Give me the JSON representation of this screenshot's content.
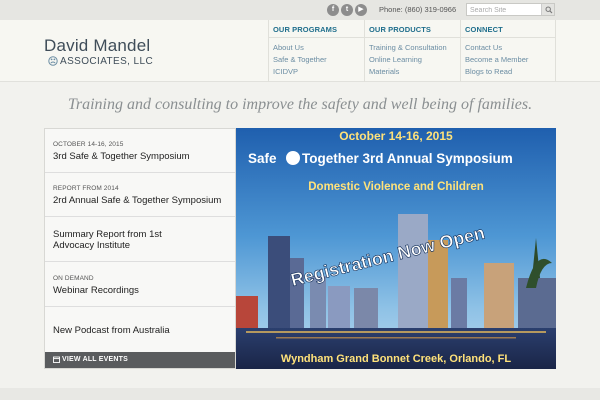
{
  "topbar": {
    "social": [
      {
        "name": "facebook-icon",
        "glyph": "f"
      },
      {
        "name": "twitter-icon",
        "glyph": "t"
      },
      {
        "name": "youtube-icon",
        "glyph": "▶"
      }
    ],
    "phone": "Phone: (860) 319-0966",
    "search_placeholder": "Search Site"
  },
  "logo": {
    "line1": "David Mandel",
    "line2": "ASSOCIATES, LLC"
  },
  "nav": [
    {
      "heading": "OUR PROGRAMS",
      "items": [
        "About Us",
        "Safe & Together",
        "ICIDVP"
      ]
    },
    {
      "heading": "OUR PRODUCTS",
      "items": [
        "Training & Consultation",
        "Online Learning",
        "Materials"
      ]
    },
    {
      "heading": "CONNECT",
      "items": [
        "Contact Us",
        "Become a Member",
        "Blogs to Read"
      ]
    }
  ],
  "tagline": "Training and consulting to improve the safety and well being of families.",
  "events": [
    {
      "date": "OCTOBER 14-16, 2015",
      "title": "3rd Safe & Together Symposium"
    },
    {
      "date": "REPORT FROM 2014",
      "title": "2rd Annual Safe & Together Symposium"
    },
    {
      "date": "",
      "title": "Summary Report from 1st Advocacy Institute"
    },
    {
      "date": "ON DEMAND",
      "title": "Webinar Recordings"
    },
    {
      "date": "",
      "title": "New Podcast from Australia"
    }
  ],
  "view_all_label": "VIEW ALL EVENTS",
  "banner": {
    "date": "October 14-16, 2015",
    "headline_a": "Safe",
    "headline_b": "Together 3rd Annual Symposium",
    "subtitle": "Domestic Violence and Children",
    "ribbon": "Registration Now Open",
    "venue": "Wyndham Grand Bonnet Creek, Orlando, FL"
  },
  "colors": {
    "nav_heading": "#1f6e8c",
    "nav_link": "#6b8da3",
    "logo": "#3f4d59",
    "banner_date": "#ffe27a"
  }
}
